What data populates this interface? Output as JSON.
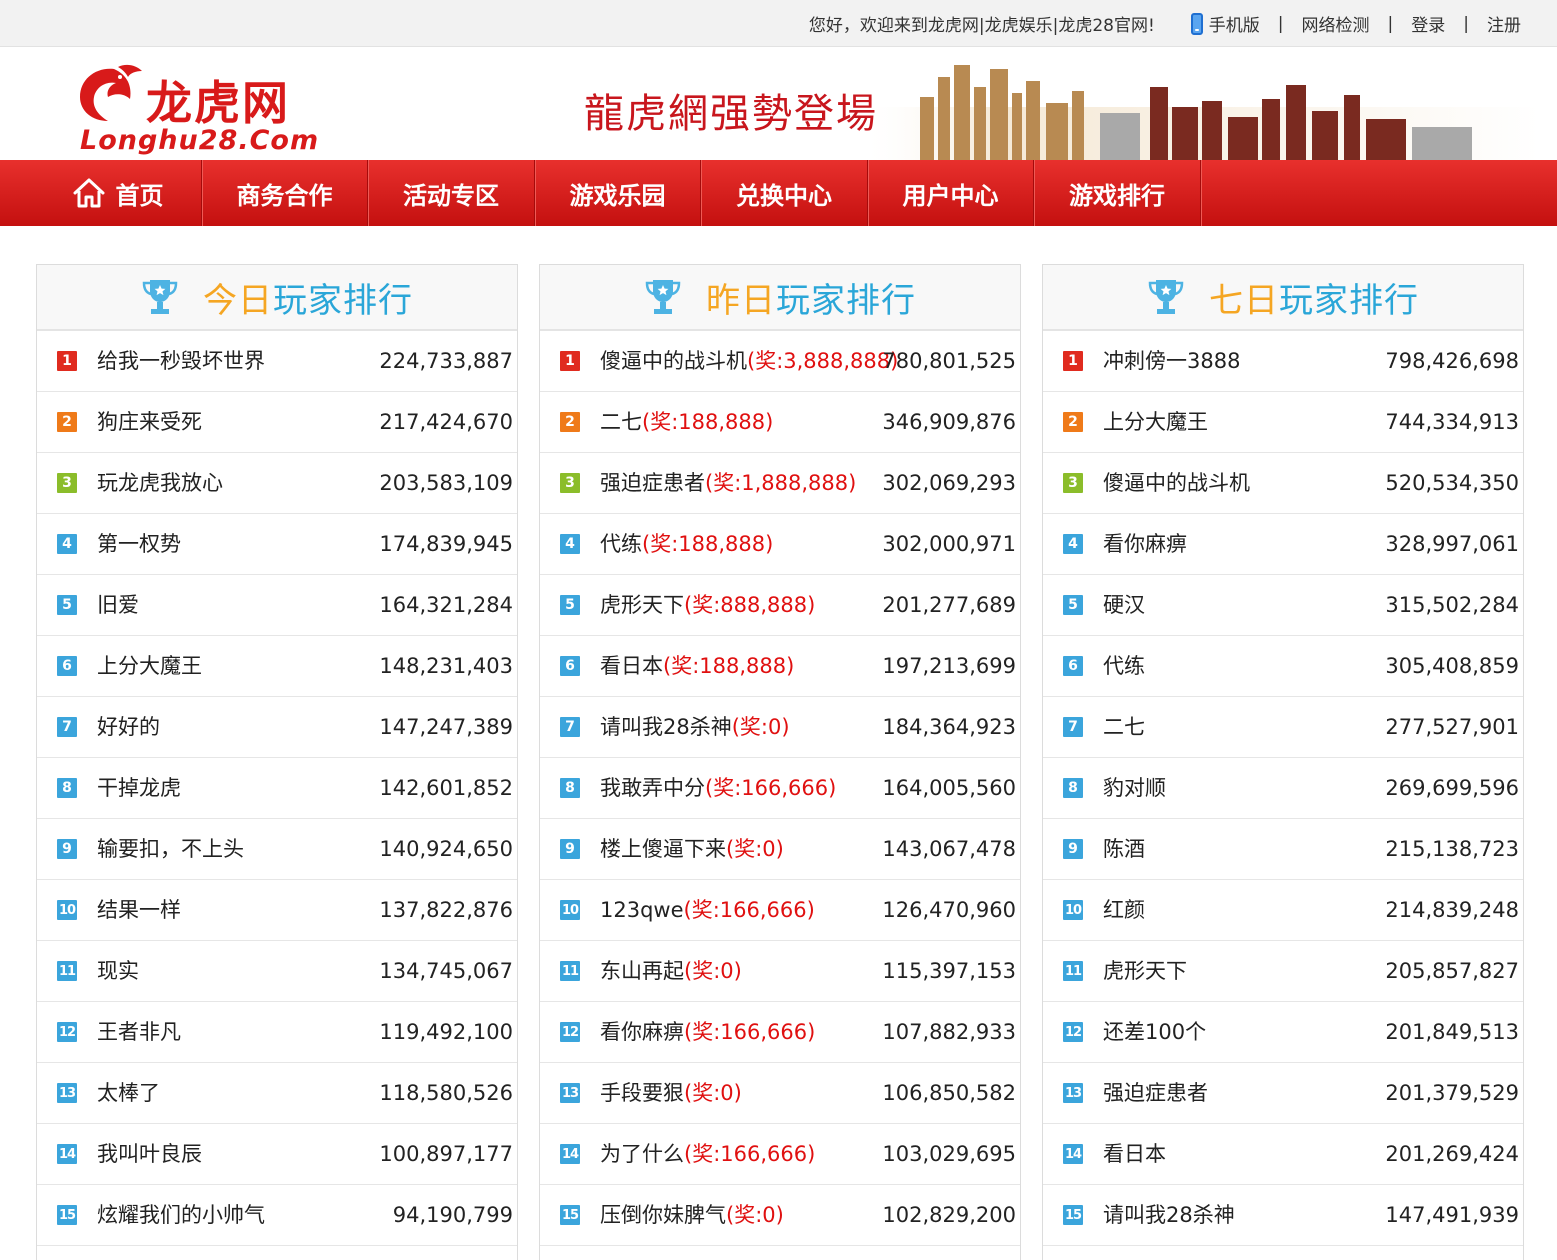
{
  "topbar": {
    "welcome": "您好，欢迎来到龙虎网|龙虎娱乐|龙虎28官网!",
    "mobile": "手机版",
    "network_check": "网络检测",
    "login": "登录",
    "register": "注册",
    "separator": "|"
  },
  "header": {
    "logo_cn": "龙虎网",
    "logo_en": "Longhu28.Com",
    "banner_text": "龍虎網强勢登場"
  },
  "nav": {
    "items": [
      {
        "label": "首页"
      },
      {
        "label": "商务合作"
      },
      {
        "label": "活动专区"
      },
      {
        "label": "游戏乐园"
      },
      {
        "label": "兑换中心"
      },
      {
        "label": "用户中心"
      },
      {
        "label": "游戏排行"
      }
    ]
  },
  "colors": {
    "brand_red": "#d81a1a",
    "prize_red": "#e01010",
    "title_blue": "#2aa6d8",
    "title_orange": "#f5a623",
    "badge_1": "#e02b1f",
    "badge_2": "#ef7a19",
    "badge_3": "#8bbd2a",
    "badge_other": "#3ba5dc"
  },
  "panels": [
    {
      "title_highlight": "今日",
      "title_rest": "玩家排行",
      "rows": [
        {
          "rank": "1",
          "name": "给我一秒毁坏世界",
          "prize": "",
          "score": "224,733,887"
        },
        {
          "rank": "2",
          "name": "狗庄来受死",
          "prize": "",
          "score": "217,424,670"
        },
        {
          "rank": "3",
          "name": "玩龙虎我放心",
          "prize": "",
          "score": "203,583,109"
        },
        {
          "rank": "4",
          "name": "第一权势",
          "prize": "",
          "score": "174,839,945"
        },
        {
          "rank": "5",
          "name": "旧爱",
          "prize": "",
          "score": "164,321,284"
        },
        {
          "rank": "6",
          "name": "上分大魔王",
          "prize": "",
          "score": "148,231,403"
        },
        {
          "rank": "7",
          "name": "好好的",
          "prize": "",
          "score": "147,247,389"
        },
        {
          "rank": "8",
          "name": "干掉龙虎",
          "prize": "",
          "score": "142,601,852"
        },
        {
          "rank": "9",
          "name": "输要扣，不上头",
          "prize": "",
          "score": "140,924,650"
        },
        {
          "rank": "10",
          "name": "结果一样",
          "prize": "",
          "score": "137,822,876"
        },
        {
          "rank": "11",
          "name": "现实",
          "prize": "",
          "score": "134,745,067"
        },
        {
          "rank": "12",
          "name": "王者非凡",
          "prize": "",
          "score": "119,492,100"
        },
        {
          "rank": "13",
          "name": "太棒了",
          "prize": "",
          "score": "118,580,526"
        },
        {
          "rank": "14",
          "name": "我叫叶良辰",
          "prize": "",
          "score": "100,897,177"
        },
        {
          "rank": "15",
          "name": "炫耀我们的小帅气",
          "prize": "",
          "score": "94,190,799"
        }
      ]
    },
    {
      "title_highlight": "昨日",
      "title_rest": "玩家排行",
      "rows": [
        {
          "rank": "1",
          "name": "傻逼中的战斗机",
          "prize": "(奖:3,888,888)",
          "score": "780,801,525"
        },
        {
          "rank": "2",
          "name": "二七",
          "prize": "(奖:188,888)",
          "score": "346,909,876"
        },
        {
          "rank": "3",
          "name": "强迫症患者",
          "prize": "(奖:1,888,888)",
          "score": "302,069,293"
        },
        {
          "rank": "4",
          "name": "代练",
          "prize": "(奖:188,888)",
          "score": "302,000,971"
        },
        {
          "rank": "5",
          "name": "虎形天下",
          "prize": "(奖:888,888)",
          "score": "201,277,689"
        },
        {
          "rank": "6",
          "name": "看日本",
          "prize": "(奖:188,888)",
          "score": "197,213,699"
        },
        {
          "rank": "7",
          "name": "请叫我28杀神",
          "prize": "(奖:0)",
          "score": "184,364,923"
        },
        {
          "rank": "8",
          "name": "我敢弄中分",
          "prize": "(奖:166,666)",
          "score": "164,005,560"
        },
        {
          "rank": "9",
          "name": "楼上傻逼下来",
          "prize": "(奖:0)",
          "score": "143,067,478"
        },
        {
          "rank": "10",
          "name": "123qwe",
          "prize": "(奖:166,666)",
          "score": "126,470,960"
        },
        {
          "rank": "11",
          "name": "东山再起",
          "prize": "(奖:0)",
          "score": "115,397,153"
        },
        {
          "rank": "12",
          "name": "看你麻痹",
          "prize": "(奖:166,666)",
          "score": "107,882,933"
        },
        {
          "rank": "13",
          "name": "手段要狠",
          "prize": "(奖:0)",
          "score": "106,850,582"
        },
        {
          "rank": "14",
          "name": "为了什么",
          "prize": "(奖:166,666)",
          "score": "103,029,695"
        },
        {
          "rank": "15",
          "name": "压倒你妹脾气",
          "prize": "(奖:0)",
          "score": "102,829,200"
        }
      ]
    },
    {
      "title_highlight": "七日",
      "title_rest": "玩家排行",
      "rows": [
        {
          "rank": "1",
          "name": "冲刺傍一3888",
          "prize": "",
          "score": "798,426,698"
        },
        {
          "rank": "2",
          "name": "上分大魔王",
          "prize": "",
          "score": "744,334,913"
        },
        {
          "rank": "3",
          "name": "傻逼中的战斗机",
          "prize": "",
          "score": "520,534,350"
        },
        {
          "rank": "4",
          "name": "看你麻痹",
          "prize": "",
          "score": "328,997,061"
        },
        {
          "rank": "5",
          "name": "硬汉",
          "prize": "",
          "score": "315,502,284"
        },
        {
          "rank": "6",
          "name": "代练",
          "prize": "",
          "score": "305,408,859"
        },
        {
          "rank": "7",
          "name": "二七",
          "prize": "",
          "score": "277,527,901"
        },
        {
          "rank": "8",
          "name": "豹对顺",
          "prize": "",
          "score": "269,699,596"
        },
        {
          "rank": "9",
          "name": "陈酒",
          "prize": "",
          "score": "215,138,723"
        },
        {
          "rank": "10",
          "name": "红颜",
          "prize": "",
          "score": "214,839,248"
        },
        {
          "rank": "11",
          "name": "虎形天下",
          "prize": "",
          "score": "205,857,827"
        },
        {
          "rank": "12",
          "name": "还差100个",
          "prize": "",
          "score": "201,849,513"
        },
        {
          "rank": "13",
          "name": "强迫症患者",
          "prize": "",
          "score": "201,379,529"
        },
        {
          "rank": "14",
          "name": "看日本",
          "prize": "",
          "score": "201,269,424"
        },
        {
          "rank": "15",
          "name": "请叫我28杀神",
          "prize": "",
          "score": "147,491,939"
        }
      ]
    }
  ]
}
